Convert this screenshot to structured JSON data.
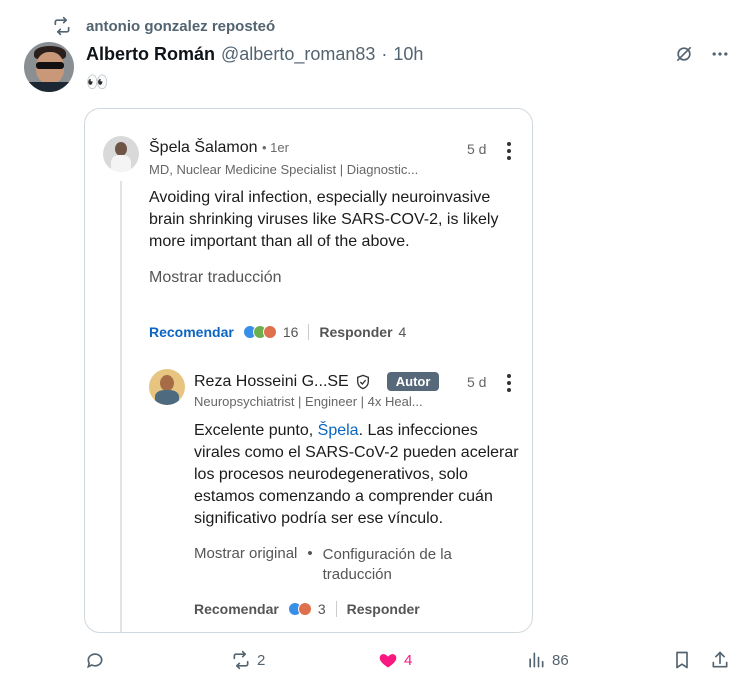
{
  "repost": {
    "text": "antonio gonzalez reposteó"
  },
  "post": {
    "author_name": "Alberto Román",
    "handle": "@alberto_roman83",
    "separator": "·",
    "time": "10h",
    "text": "👀"
  },
  "card": {
    "comment1": {
      "name": "Špela Šalamon",
      "degree": "• 1er",
      "subtitle": "MD, Nuclear Medicine Specialist | Diagnostic...",
      "time": "5 d",
      "body": "Avoiding viral infection, especially neuroinvasive brain shrinking viruses like SARS-COV-2, is likely more important than all of the above.",
      "translate": "Mostrar traducción",
      "recommend": "Recomendar",
      "reaction_count": "16",
      "reply": "Responder",
      "reply_count": "4"
    },
    "comment2": {
      "name": "Reza Hosseini G...SE",
      "badge": "Autor",
      "subtitle": "Neuropsychiatrist | Engineer | 4x Heal...",
      "time": "5 d",
      "body_prefix": "Excelente punto, ",
      "mention": "Špela",
      "body_suffix": ". Las infecciones virales como el SARS-CoV-2 pueden acelerar los procesos neurodegenerativos, solo estamos comenzando a comprender cuán significativo podría ser ese vínculo.",
      "show_original": "Mostrar original",
      "bullet": "•",
      "translation_settings": "Configuración de la traducción",
      "recommend": "Recomendar",
      "reaction_count": "3",
      "reply": "Responder"
    }
  },
  "actions": {
    "reposts": "2",
    "likes": "4",
    "views": "86"
  },
  "colors": {
    "like_pink": "#f91880",
    "linkedin_blue": "#0a66c2",
    "muted": "#536471"
  }
}
